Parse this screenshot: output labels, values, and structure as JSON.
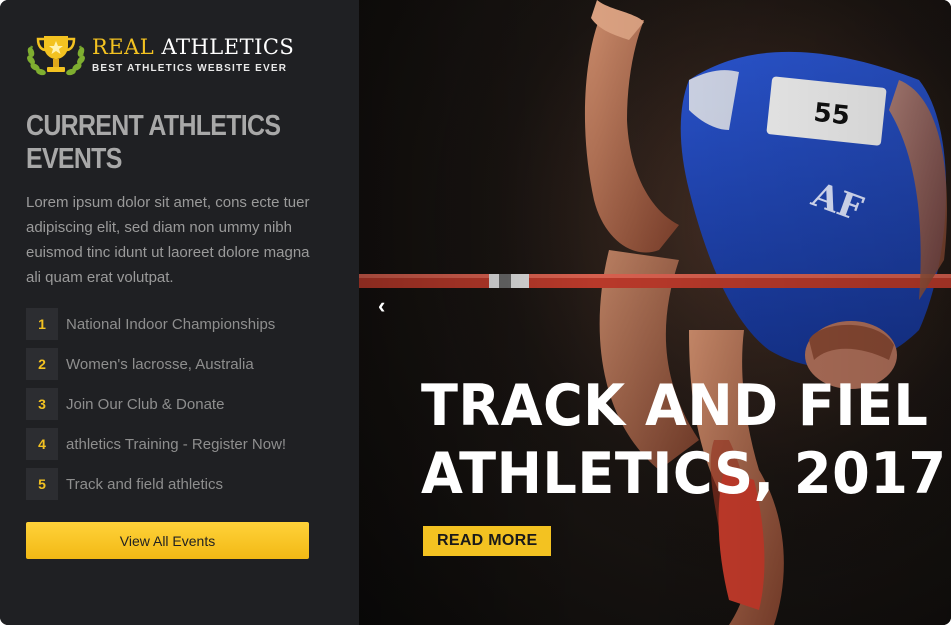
{
  "brand": {
    "title_part1": "REAL",
    "title_part2": "ATHLETICS",
    "tagline": "BEST ATHLETICS WEBSITE EVER",
    "logo_icon": "trophy-icon"
  },
  "sidebar": {
    "heading": "CURRENT ATHLETICS EVENTS",
    "description": "Lorem ipsum dolor sit amet, cons ecte tuer adipiscing elit, sed diam non ummy nibh euismod tinc idunt ut laoreet dolore magna ali quam erat volutpat.",
    "events": [
      {
        "num": "1",
        "label": "National Indoor Championships"
      },
      {
        "num": "2",
        "label": "Women's lacrosse, Australia"
      },
      {
        "num": "3",
        "label": "Join Our Club & Donate"
      },
      {
        "num": "4",
        "label": "athletics Training - Register Now!"
      },
      {
        "num": "5",
        "label": "Track and field athletics"
      }
    ],
    "view_all_label": "View All Events"
  },
  "hero": {
    "prev_arrow": "‹",
    "title_line1": "TRACK AND FIEL",
    "title_line2": "ATHLETICS, 2017",
    "read_more_label": "READ MORE",
    "bib_number": "55",
    "jersey_text": "AF"
  },
  "colors": {
    "accent": "#f3c221",
    "sidebar_bg": "#1f2023",
    "jersey": "#1f45b8"
  }
}
